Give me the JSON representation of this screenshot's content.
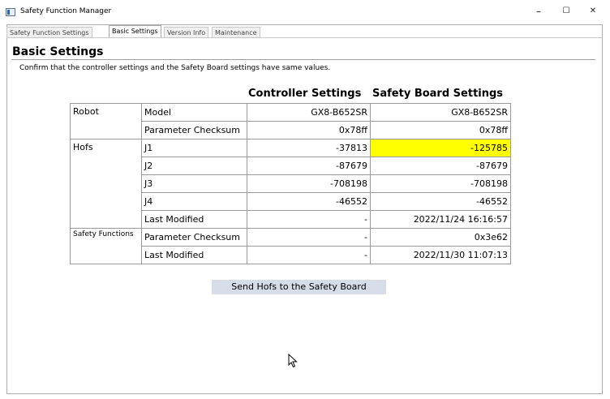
{
  "window": {
    "title": "Safety Function Manager",
    "minimize": "–",
    "maximize": "☐",
    "close": "✕"
  },
  "tabs": [
    {
      "label": "Safety Function Settings"
    },
    {
      "label": "Basic Settings"
    },
    {
      "label": "Version Info"
    },
    {
      "label": "Maintenance"
    }
  ],
  "active_tab": "Basic Settings",
  "page": {
    "heading": "Basic Settings",
    "instruction": "Confirm that the controller settings and the Safety Board settings have same values."
  },
  "table": {
    "headers": {
      "controller": "Controller Settings",
      "safety_board": "Safety Board Settings"
    },
    "groups": {
      "robot": "Robot",
      "hofs": "Hofs",
      "safety_functions": "Safety Functions"
    },
    "rows": [
      {
        "param": "Model",
        "controller": "GX8-B652SR",
        "board": "GX8-B652SR"
      },
      {
        "param": "Parameter Checksum",
        "controller": "0x78ff",
        "board": "0x78ff"
      },
      {
        "param": "J1",
        "controller": "-37813",
        "board": "-125785",
        "mismatch": true
      },
      {
        "param": "J2",
        "controller": "-87679",
        "board": "-87679"
      },
      {
        "param": "J3",
        "controller": "-708198",
        "board": "-708198"
      },
      {
        "param": "J4",
        "controller": "-46552",
        "board": "-46552"
      },
      {
        "param": "Last Modified",
        "controller": "-",
        "board": "2022/11/24 16:16:57"
      },
      {
        "param": "Parameter Checksum",
        "controller": "-",
        "board": "0x3e62"
      },
      {
        "param": "Last Modified",
        "controller": "-",
        "board": "2022/11/30 11:07:13"
      }
    ]
  },
  "button": {
    "send_label": "Send Hofs to the Safety Board"
  },
  "colors": {
    "mismatch_highlight": "#ffff00",
    "button_bg": "#d7dde8"
  }
}
